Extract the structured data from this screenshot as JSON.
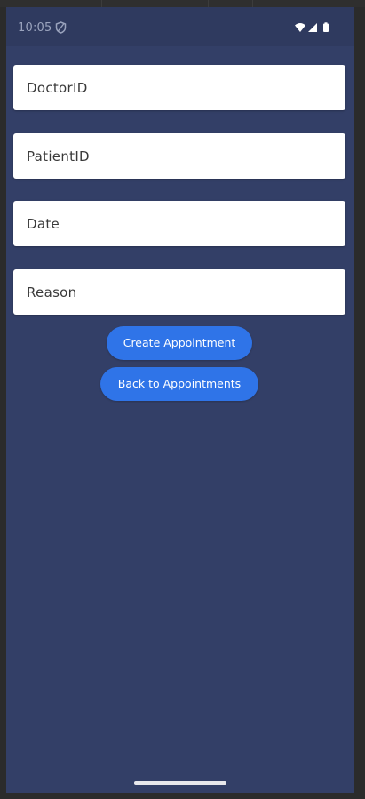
{
  "status_bar": {
    "time": "10:05",
    "icons": [
      "shield-icon",
      "wifi-icon",
      "signal-icon",
      "battery-icon"
    ]
  },
  "form": {
    "fields": [
      {
        "placeholder": "DoctorID",
        "value": ""
      },
      {
        "placeholder": "PatientID",
        "value": ""
      },
      {
        "placeholder": "Date",
        "value": ""
      },
      {
        "placeholder": "Reason",
        "value": ""
      }
    ]
  },
  "buttons": {
    "create_label": "Create Appointment",
    "back_label": "Back to Appointments"
  },
  "colors": {
    "background": "#333f67",
    "button": "#2f74e8",
    "field": "#ffffff"
  }
}
